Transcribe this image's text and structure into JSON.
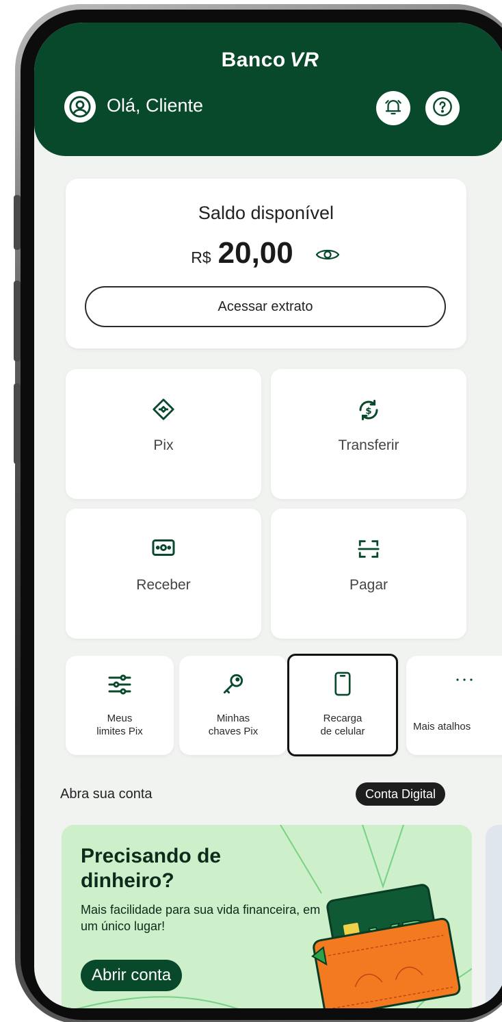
{
  "header": {
    "brand": "Banco",
    "brand_mark": "VR",
    "greeting": "Olá, Cliente",
    "icons": {
      "profile": "user-circle-icon",
      "notifications": "bell-icon",
      "help": "question-icon"
    }
  },
  "balance": {
    "title": "Saldo disponível",
    "currency": "R$",
    "value": "20,00",
    "visibility_icon": "eye-icon",
    "statement_button": "Acessar extrato"
  },
  "actions": [
    {
      "label": "Pix",
      "icon": "pix-icon"
    },
    {
      "label": "Transferir",
      "icon": "transfer-icon"
    },
    {
      "label": "Receber",
      "icon": "receive-money-icon"
    },
    {
      "label": "Pagar",
      "icon": "barcode-scan-icon"
    }
  ],
  "shortcuts": [
    {
      "label": "Meus\nlimites Pix",
      "icon": "sliders-icon"
    },
    {
      "label": "Minhas\nchaves Pix",
      "icon": "key-icon"
    },
    {
      "label": "Recarga\nde celular",
      "icon": "phone-icon",
      "selected": true
    },
    {
      "label": "Mais atalhos",
      "icon": "more-icon"
    }
  ],
  "account_section": {
    "title": "Abra sua conta",
    "chip": "Conta Digital"
  },
  "promo": {
    "title": "Precisando de dinheiro?",
    "text": "Mais facilidade para sua vida financeira, em um único lugar!",
    "button": "Abrir conta",
    "card_logo": "VR"
  },
  "colors": {
    "brand_green": "#08482b",
    "promo_bg": "#cdefc9",
    "wallet_orange": "#f47a22",
    "screen_bg": "#f1f3f1"
  }
}
